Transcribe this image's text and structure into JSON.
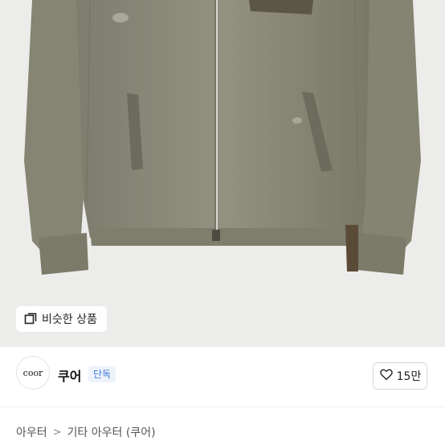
{
  "similar_button": {
    "label": "비슷한 상품",
    "icon": "similar-items-icon"
  },
  "seller": {
    "avatar_text": "coor",
    "name": "쿠어",
    "badge": "단독"
  },
  "like": {
    "icon": "heart-outline-icon",
    "count": "15만"
  },
  "breadcrumb": {
    "items": [
      "아우터",
      "기타 아우터 (쿠어)"
    ],
    "separator": ">"
  },
  "colors": {
    "photo_background": "#ececea",
    "jacket": "#8b8978",
    "badge_text": "#3c79d8",
    "badge_background": "#eef3fb"
  }
}
